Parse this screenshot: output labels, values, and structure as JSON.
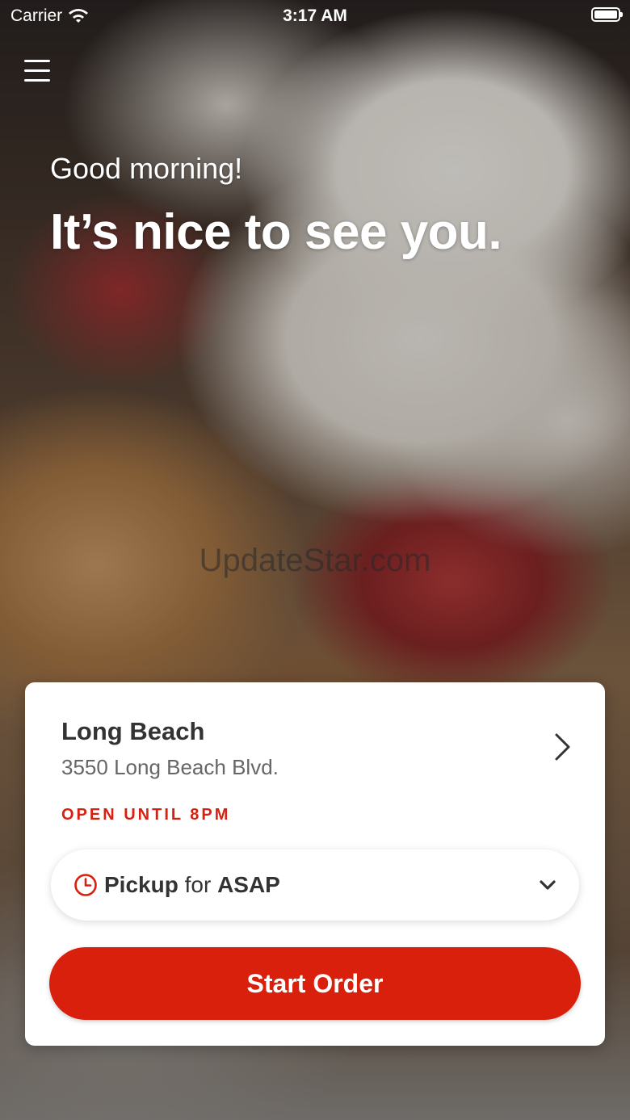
{
  "status_bar": {
    "carrier": "Carrier",
    "time": "3:17 AM"
  },
  "hero": {
    "greeting": "Good morning!",
    "headline": "It’s nice to see you.",
    "watermark": "UpdateStar.com"
  },
  "location": {
    "name": "Long Beach",
    "address": "3550 Long Beach Blvd.",
    "status": "OPEN UNTIL 8PM"
  },
  "order_mode": {
    "mode": "Pickup",
    "connector": "for",
    "time": "ASAP"
  },
  "start_button": {
    "label": "Start Order"
  },
  "colors": {
    "accent": "#d9200d",
    "text_dark": "#333333",
    "text_muted": "#666666"
  },
  "icons": [
    "wifi-icon",
    "battery-icon",
    "hamburger-menu-icon",
    "chevron-right-icon",
    "clock-icon",
    "chevron-down-icon"
  ]
}
